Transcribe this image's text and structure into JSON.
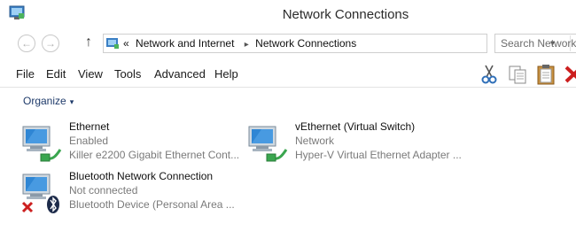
{
  "window": {
    "title": "Network Connections"
  },
  "nav": {
    "back_glyph": "←",
    "forward_glyph": "→",
    "up_glyph": "↑",
    "address": {
      "prefix": "«",
      "segments": [
        "Network and Internet",
        "Network Connections"
      ],
      "separator": "▸",
      "dropdown_glyph": "▾",
      "refresh_glyph": "⟳"
    },
    "search": {
      "placeholder": "Search Network Connections"
    }
  },
  "menu": {
    "items": [
      "File",
      "Edit",
      "View",
      "Tools",
      "Advanced",
      "Help"
    ]
  },
  "toolbar": {
    "icons": [
      "scissors-icon",
      "copy-icon",
      "paste-icon",
      "delete-icon"
    ]
  },
  "command_bar": {
    "organize_label": "Organize",
    "organize_caret": "▾"
  },
  "connections": [
    {
      "name": "Ethernet",
      "status": "Enabled",
      "device": "Killer e2200 Gigabit Ethernet Cont...",
      "icon": "ethernet-adapter-icon"
    },
    {
      "name": "vEthernet (Virtual Switch)",
      "status": "Network",
      "device": "Hyper-V Virtual Ethernet Adapter ...",
      "icon": "ethernet-adapter-icon"
    },
    {
      "name": "Bluetooth Network Connection",
      "status": "Not connected",
      "device": "Bluetooth Device (Personal Area ...",
      "icon": "bluetooth-adapter-icon",
      "overlay": "disconnected-x-icon"
    }
  ],
  "colors": {
    "accent": "#1e3a6a",
    "status_text": "#7a7a7a",
    "monitor_blue": "#2f86d4",
    "cable_green": "#3aa64f",
    "error_red": "#cc1f1f"
  }
}
